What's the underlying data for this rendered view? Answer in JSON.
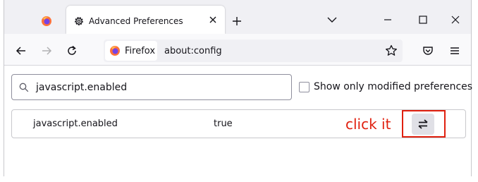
{
  "tab": {
    "title": "Advanced Preferences"
  },
  "urlbar": {
    "identity_label": "Firefox",
    "url": "about:config"
  },
  "search": {
    "value": "javascript.enabled"
  },
  "filter": {
    "label": "Show only modified preferences",
    "checked": false
  },
  "preferences": [
    {
      "name": "javascript.enabled",
      "value": "true"
    }
  ],
  "annotation": {
    "text": "click it",
    "color": "#e0200f"
  },
  "colors": {
    "firefox_orange": "#ff7139",
    "firefox_purple": "#7542e5",
    "annotation_red": "#e0200f"
  }
}
